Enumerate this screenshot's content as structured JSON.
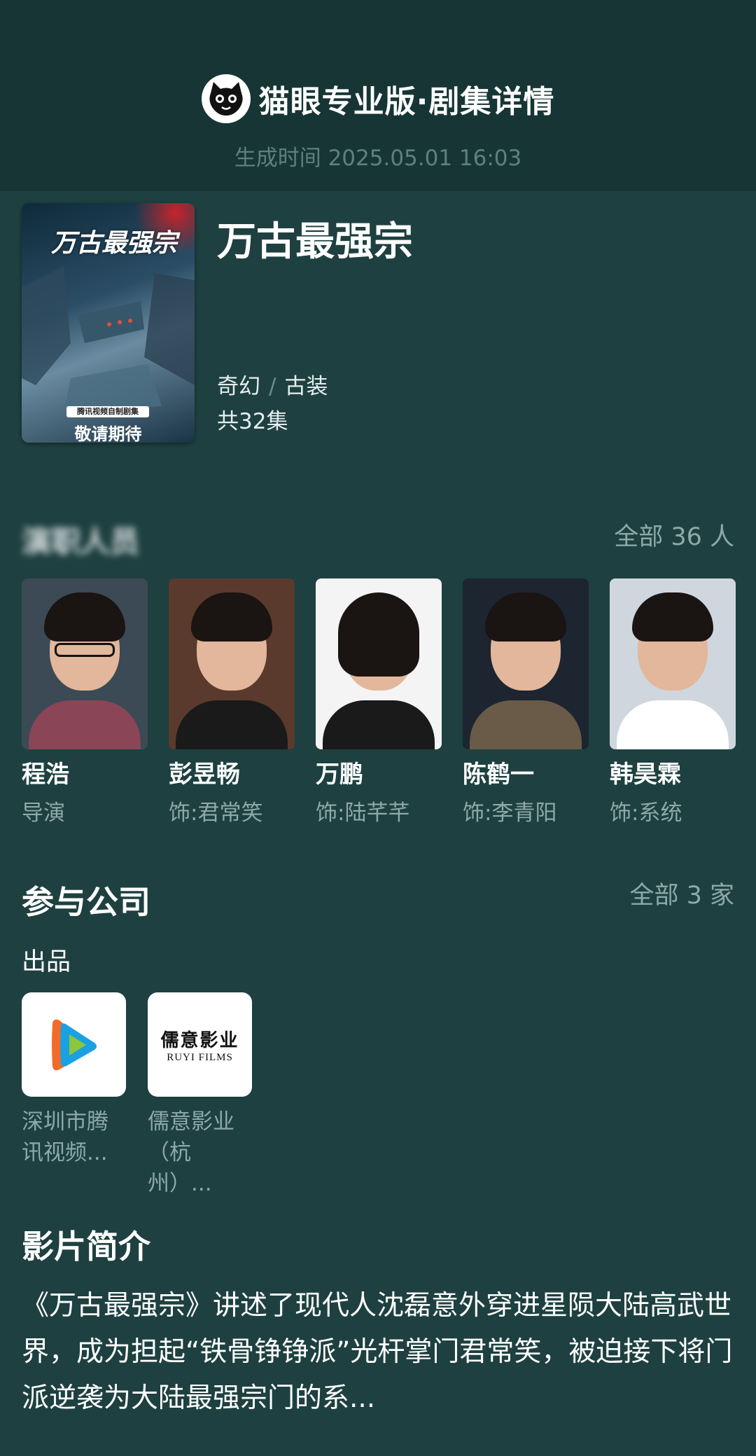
{
  "header": {
    "brand": "猫眼专业版",
    "page_title": "·剧集详情",
    "generated_time": "生成时间 2025.05.01 16:03",
    "logo_icon": "cat-face-icon"
  },
  "show": {
    "title": "万古最强宗",
    "poster_title_art": "万古最强宗",
    "poster_tag": "腾讯视频自制剧集",
    "poster_caption": "敬请期待",
    "genres": [
      "奇幻",
      "古装"
    ],
    "genre_separator": "/",
    "episodes": "共32集"
  },
  "cast": {
    "heading": "演职人员",
    "all_label": "全部 36 人",
    "members": [
      {
        "name": "程浩",
        "role": "导演",
        "bg": "#3b4a55",
        "shirt": "#8a4556",
        "glasses": true
      },
      {
        "name": "彭昱畅",
        "role": "饰:君常笑",
        "bg": "#5a3a2c",
        "shirt": "#1a1a1a",
        "glasses": false
      },
      {
        "name": "万鹏",
        "role": "饰:陆芊芊",
        "bg": "#f4f4f4",
        "shirt": "#1a1a1a",
        "glasses": false
      },
      {
        "name": "陈鹤一",
        "role": "饰:李青阳",
        "bg": "#1c2530",
        "shirt": "#6a5a48",
        "glasses": false
      },
      {
        "name": "韩昊霖",
        "role": "饰:系统",
        "bg": "#cfd6de",
        "shirt": "#ffffff",
        "glasses": false
      }
    ]
  },
  "companies": {
    "heading": "参与公司",
    "all_label": "全部 3 家",
    "produced_label": "出品",
    "items": [
      {
        "name_line1": "深圳市腾",
        "name_line2": "讯视频...",
        "logo": "tencent-video-icon"
      },
      {
        "name_line1": "儒意影业",
        "name_line2": "（杭州）...",
        "logo_cn": "儒意影业",
        "logo_en": "RUYI FILMS"
      }
    ]
  },
  "synopsis": {
    "heading": "影片简介",
    "text": "《万古最强宗》讲述了现代人沈磊意外穿进星陨大陆高武世界，成为担起“铁骨铮铮派”光杆掌门君常笑，被迫接下将门派逆袭为大陆最强宗门的系..."
  }
}
